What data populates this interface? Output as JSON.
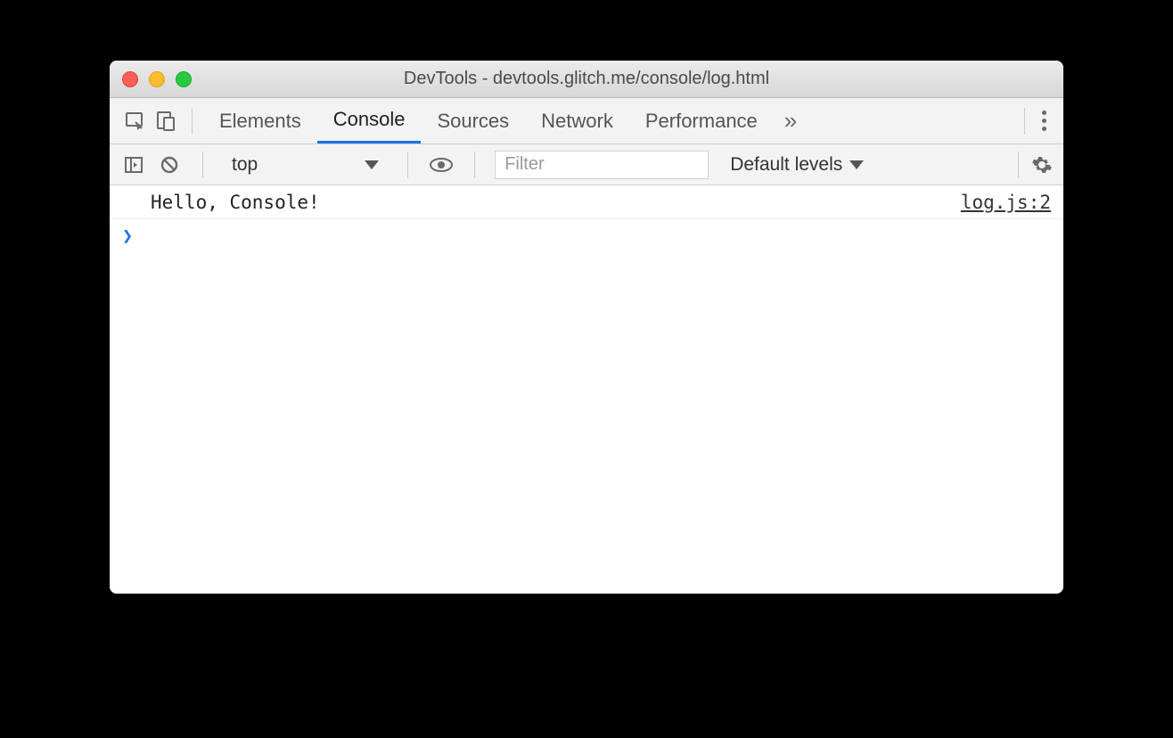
{
  "window": {
    "title": "DevTools - devtools.glitch.me/console/log.html"
  },
  "tabs": {
    "elements": "Elements",
    "console": "Console",
    "sources": "Sources",
    "network": "Network",
    "performance": "Performance"
  },
  "toolbar": {
    "context": "top",
    "filter_placeholder": "Filter",
    "levels": "Default levels"
  },
  "console": {
    "log_message": "Hello, Console!",
    "log_source": "log.js:2"
  }
}
